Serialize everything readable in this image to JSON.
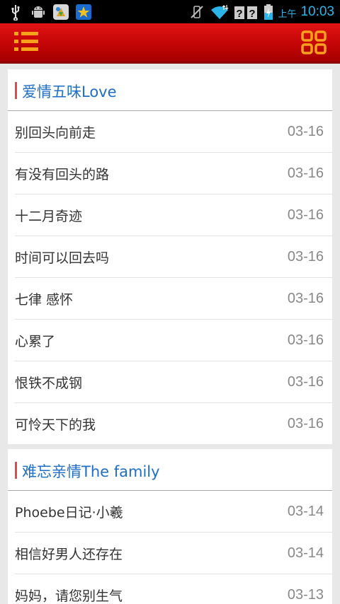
{
  "status_bar": {
    "ampm": "上午",
    "time": "10:03",
    "icons": [
      "usb-icon",
      "android-debug-icon",
      "app-store-icon",
      "star-app-icon",
      "vibrate-off-icon",
      "wifi-icon",
      "signal-unknown-icon",
      "battery-charging-icon"
    ]
  },
  "header": {
    "menu_icon": "list-menu-icon",
    "grid_icon": "grid-icon",
    "accent": "#cc0000"
  },
  "sections": [
    {
      "title": "爱情五味Love",
      "items": [
        {
          "title": "别回头向前走",
          "date": "03-16"
        },
        {
          "title": "有没有回头的路",
          "date": "03-16"
        },
        {
          "title": "十二月奇迹",
          "date": "03-16"
        },
        {
          "title": "时间可以回去吗",
          "date": "03-16"
        },
        {
          "title": "七律 感怀",
          "date": "03-16"
        },
        {
          "title": "心累了",
          "date": "03-16"
        },
        {
          "title": "恨铁不成钢",
          "date": "03-16"
        },
        {
          "title": "可怜天下的我",
          "date": "03-16"
        }
      ]
    },
    {
      "title": "难忘亲情The family",
      "items": [
        {
          "title": "Phoebe日记·小羲",
          "date": "03-14"
        },
        {
          "title": "相信好男人还存在",
          "date": "03-14"
        },
        {
          "title": "妈妈，请您别生气",
          "date": "03-13"
        }
      ]
    }
  ]
}
